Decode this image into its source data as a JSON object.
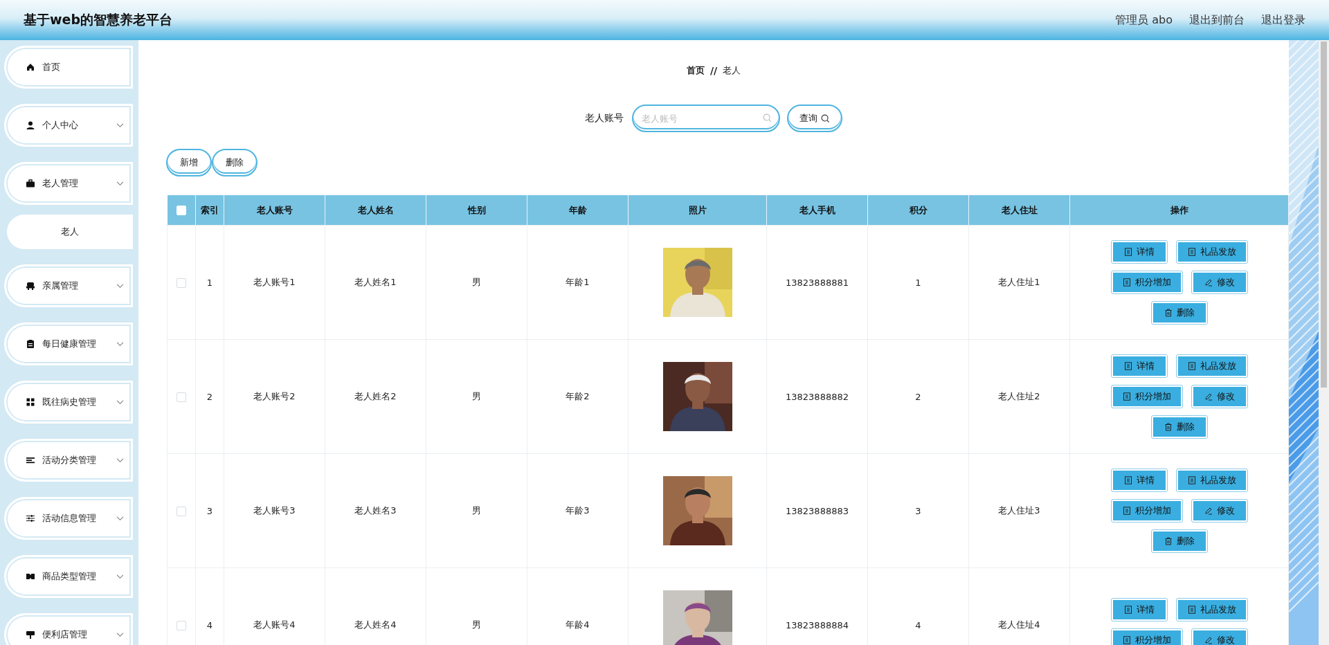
{
  "header": {
    "title": "基于web的智慧养老平台",
    "links": [
      "管理员 abo",
      "退出到前台",
      "退出登录"
    ]
  },
  "sidebar": {
    "items": [
      {
        "label": "首页",
        "has_submenu": false
      },
      {
        "label": "个人中心",
        "has_submenu": true
      },
      {
        "label": "老人管理",
        "has_submenu": true,
        "children": [
          {
            "label": "老人"
          }
        ]
      },
      {
        "label": "亲属管理",
        "has_submenu": true
      },
      {
        "label": "每日健康管理",
        "has_submenu": true
      },
      {
        "label": "既往病史管理",
        "has_submenu": true
      },
      {
        "label": "活动分类管理",
        "has_submenu": true
      },
      {
        "label": "活动信息管理",
        "has_submenu": true
      },
      {
        "label": "商品类型管理",
        "has_submenu": true
      },
      {
        "label": "便利店管理",
        "has_submenu": true
      }
    ]
  },
  "breadcrumb": {
    "items": [
      "首页",
      "老人"
    ],
    "separator": "//"
  },
  "search": {
    "label": "老人账号",
    "placeholder": "老人账号",
    "button": "查询"
  },
  "toolbar": [
    "新增",
    "删除"
  ],
  "table": {
    "select_all": {
      "checked": false
    },
    "columns": [
      "索引",
      "老人账号",
      "老人姓名",
      "性别",
      "年龄",
      "照片",
      "老人手机",
      "积分",
      "老人住址",
      "操作"
    ],
    "rows": [
      {
        "checked": false,
        "index": "1",
        "account": "老人账号1",
        "name": "老人姓名1",
        "gender": "男",
        "age": "年龄1",
        "phone": "13823888881",
        "points": "1",
        "address": "老人住址1",
        "actions": [
          {
            "label": "详情",
            "kind": "doc"
          },
          {
            "label": "礼品发放",
            "kind": "doc"
          },
          {
            "label": "积分增加",
            "kind": "doc"
          },
          {
            "label": "修改",
            "kind": "edit"
          },
          {
            "label": "删除",
            "kind": "delete"
          }
        ]
      },
      {
        "checked": false,
        "index": "2",
        "account": "老人账号2",
        "name": "老人姓名2",
        "gender": "男",
        "age": "年龄2",
        "phone": "13823888882",
        "points": "2",
        "address": "老人住址2",
        "actions": [
          {
            "label": "详情",
            "kind": "doc"
          },
          {
            "label": "礼品发放",
            "kind": "doc"
          },
          {
            "label": "积分增加",
            "kind": "doc"
          },
          {
            "label": "修改",
            "kind": "edit"
          },
          {
            "label": "删除",
            "kind": "delete"
          }
        ]
      },
      {
        "checked": false,
        "index": "3",
        "account": "老人账号3",
        "name": "老人姓名3",
        "gender": "男",
        "age": "年龄3",
        "phone": "13823888883",
        "points": "3",
        "address": "老人住址3",
        "actions": [
          {
            "label": "详情",
            "kind": "doc"
          },
          {
            "label": "礼品发放",
            "kind": "doc"
          },
          {
            "label": "积分增加",
            "kind": "doc"
          },
          {
            "label": "修改",
            "kind": "edit"
          },
          {
            "label": "删除",
            "kind": "delete"
          }
        ]
      },
      {
        "checked": false,
        "index": "4",
        "account": "老人账号4",
        "name": "老人姓名4",
        "gender": "男",
        "age": "年龄4",
        "phone": "13823888884",
        "points": "4",
        "address": "老人住址4",
        "actions": [
          {
            "label": "详情",
            "kind": "doc"
          },
          {
            "label": "礼品发放",
            "kind": "doc"
          },
          {
            "label": "积分增加",
            "kind": "doc"
          },
          {
            "label": "修改",
            "kind": "edit"
          }
        ]
      }
    ]
  }
}
